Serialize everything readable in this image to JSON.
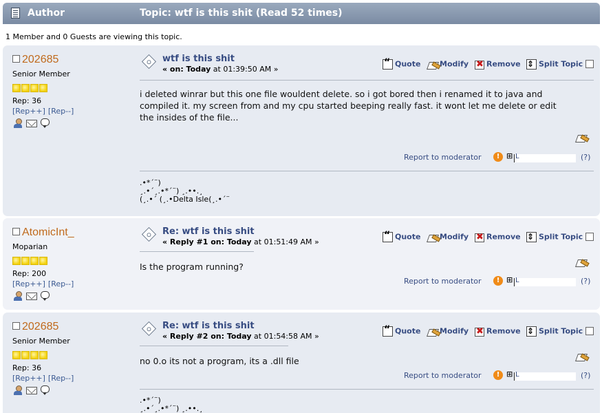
{
  "header": {
    "author_label": "Author",
    "topic_label": "Topic: wtf is this shit  (Read 52 times)"
  },
  "viewing": "1 Member and 0 Guests are viewing this topic.",
  "actions": {
    "quote": "Quote",
    "modify": "Modify",
    "remove": "Remove",
    "split": "Split Topic",
    "report": "Report to moderator",
    "ip_help": "(?)"
  },
  "posts": [
    {
      "username": "202685",
      "rank": "Senior Member",
      "stars": 4,
      "rep": "Rep: 36",
      "rep_plus": "[Rep++]",
      "rep_minus": "[Rep--]",
      "subject": "wtf is this shit",
      "meta_prefix": "« on: Today",
      "meta_time": " at 01:39:50 AM »",
      "body": "i deleted winrar but this one file wouldent delete. so i got bored then i renamed it to java and compiled it. my screen from and my cpu started beeping really fast. it wont let me delete or edit the insides of the file...",
      "ip_prefix": "L",
      "signature": ".•*´¨)\n¸.•´¸.•*´¨) ¸.••.¸\n(¸.•´ (¸.•Delta Isle(¸.•´¨"
    },
    {
      "username": "AtomicInt_",
      "rank": "Moparian",
      "stars": 4,
      "rep": "Rep: 200",
      "rep_plus": "[Rep++]",
      "rep_minus": "[Rep--]",
      "subject": "Re: wtf is this shit",
      "meta_prefix": "« Reply #1 on: Today",
      "meta_time": " at 01:51:49 AM »",
      "body": "Is the program running?",
      "ip_prefix": "L"
    },
    {
      "username": "202685",
      "rank": "Senior Member",
      "stars": 4,
      "rep": "Rep: 36",
      "rep_plus": "[Rep++]",
      "rep_minus": "[Rep--]",
      "subject": "Re: wtf is this shit",
      "meta_prefix": "« Reply #2 on: Today",
      "meta_time": " at 01:54:58 AM »",
      "body": "no 0.o its not a program, its a .dll file",
      "ip_prefix": "L",
      "signature": ".•*´¨)\n¸.•´¸.•*´¨) ¸.••.¸"
    }
  ]
}
